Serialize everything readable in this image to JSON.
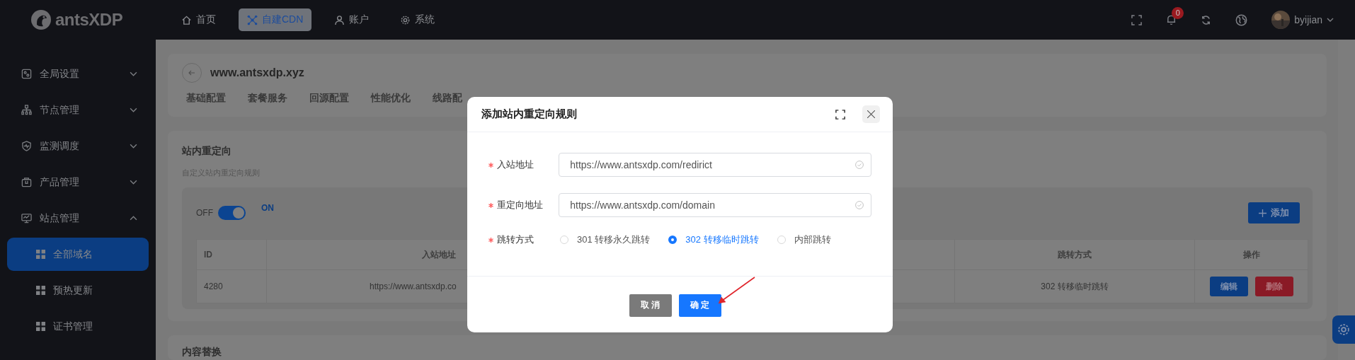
{
  "topbar": {
    "logo": "antsXDP",
    "nav": [
      {
        "label": "首页",
        "selected": false
      },
      {
        "label": "自建CDN",
        "selected": true
      },
      {
        "label": "账户",
        "selected": false
      },
      {
        "label": "系统",
        "selected": false
      }
    ],
    "notifications": "0",
    "user": "byijian"
  },
  "sidebar": {
    "items": [
      {
        "label": "全局设置",
        "expanded": false
      },
      {
        "label": "节点管理",
        "expanded": false
      },
      {
        "label": "监测调度",
        "expanded": false
      },
      {
        "label": "产品管理",
        "expanded": false
      },
      {
        "label": "站点管理",
        "expanded": true,
        "children": [
          {
            "label": "全部域名",
            "selected": true
          },
          {
            "label": "预热更新",
            "selected": false
          },
          {
            "label": "证书管理",
            "selected": false
          }
        ]
      }
    ]
  },
  "site": {
    "domain": "www.antsxdp.xyz",
    "tabs": [
      "基础配置",
      "套餐服务",
      "回源配置",
      "性能优化",
      "线路配"
    ]
  },
  "redirect_section": {
    "title": "站内重定向",
    "description": "自定义站内重定向规则",
    "switch": {
      "off_label": "OFF",
      "on_label": "ON",
      "on": true
    },
    "add_button": "添加",
    "table": {
      "columns": [
        "ID",
        "入站地址",
        "跳转方式",
        "操作"
      ],
      "rows": [
        {
          "id": "4280",
          "source": "https://www.antsxdp.co",
          "mode": "302 转移临时跳转",
          "actions": [
            "编辑",
            "删除"
          ]
        }
      ]
    }
  },
  "next_section": {
    "title": "内容替换"
  },
  "modal": {
    "title": "添加站内重定向规则",
    "fields": [
      {
        "label": "入站地址",
        "required": true,
        "value": "https://www.antsxdp.com/redirict",
        "valid": true
      },
      {
        "label": "重定向地址",
        "required": true,
        "value": "https://www.antsxdp.com/domain",
        "valid": true
      }
    ],
    "radio": {
      "label": "跳转方式",
      "required": true,
      "options": [
        {
          "label": "301 转移永久跳转",
          "selected": false
        },
        {
          "label": "302 转移临时跳转",
          "selected": true
        },
        {
          "label": "内部跳转",
          "selected": false
        }
      ]
    },
    "buttons": [
      {
        "label": "取 消",
        "kind": "secondary"
      },
      {
        "label": "确 定",
        "kind": "primary"
      }
    ]
  }
}
